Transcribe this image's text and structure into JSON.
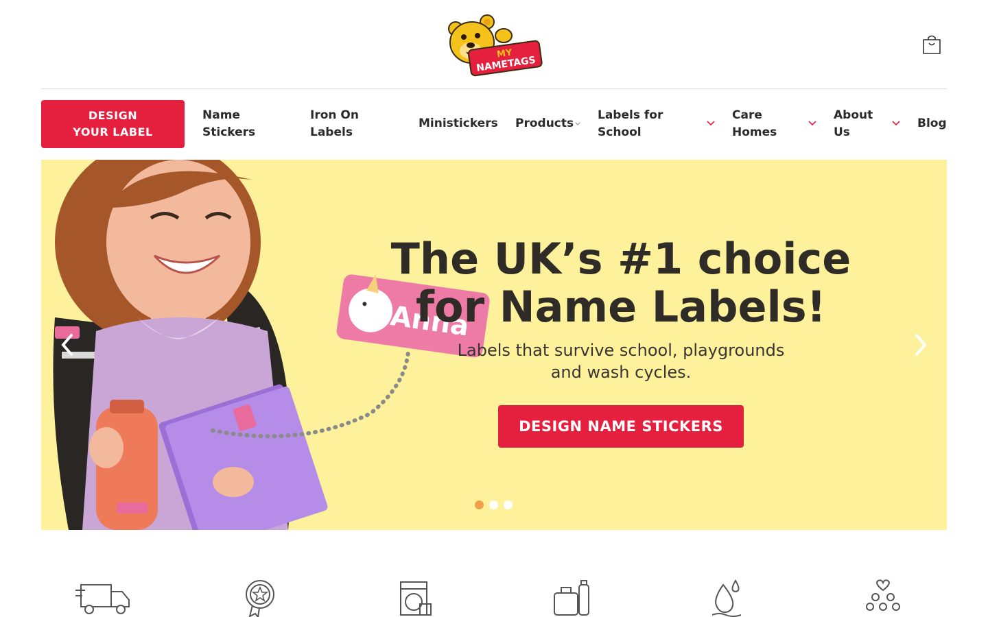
{
  "header": {
    "logo": {
      "line1": "MY",
      "line2": "NAMETAGS"
    },
    "cart_icon": "shopping-bag-icon"
  },
  "nav": {
    "design_label": "DESIGN YOUR LABEL",
    "items": [
      {
        "label": "Name Stickers",
        "dropdown": false
      },
      {
        "label": "Iron On Labels",
        "dropdown": false
      },
      {
        "label": "Ministickers",
        "dropdown": false
      },
      {
        "label": "Products",
        "dropdown": true
      },
      {
        "label": "Labels for School",
        "dropdown": true
      },
      {
        "label": "Care Homes",
        "dropdown": true
      },
      {
        "label": "About Us",
        "dropdown": true
      },
      {
        "label": "Blog",
        "dropdown": false
      }
    ]
  },
  "hero": {
    "title": "The UK’s #1 choice for Name Labels!",
    "subtitle": "Labels that survive school, playgrounds and wash cycles.",
    "cta": "DESIGN NAME STICKERS",
    "label_name": "Anna",
    "active_slide": 1,
    "slide_count": 3
  },
  "features": {
    "icons": [
      "delivery-truck-icon",
      "award-badge-icon",
      "washing-machine-icon",
      "lunchbox-bottle-icon",
      "waterproof-drop-icon",
      "community-heart-icon"
    ]
  },
  "colors": {
    "brand_red": "#e5203f",
    "hero_yellow": "#fdf19c",
    "dot_active": "#f0a04b",
    "text_dark": "#2b2b2b"
  }
}
